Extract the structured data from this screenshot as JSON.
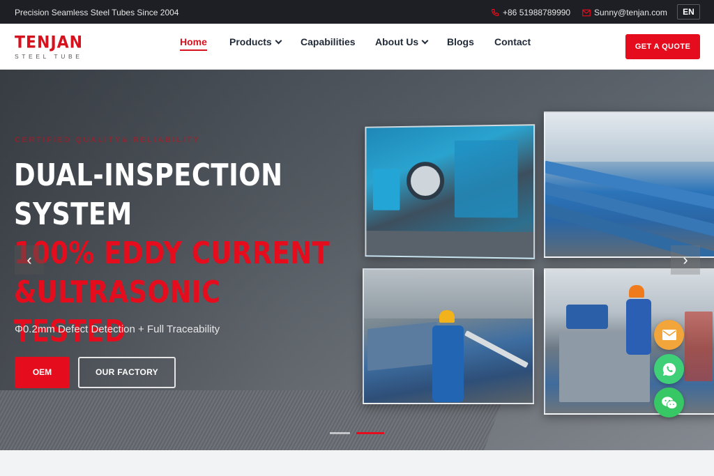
{
  "topbar": {
    "tagline": "Precision Seamless Steel Tubes Since 2004",
    "phone": "+86 51988789990",
    "email": "Sunny@tenjan.com",
    "language": "EN"
  },
  "header": {
    "logo_brand": "TENJAN",
    "logo_sub": "STEEL TUBE",
    "nav": [
      {
        "label": "Home",
        "active": true
      },
      {
        "label": "Products",
        "dropdown": true
      },
      {
        "label": "Capabilities"
      },
      {
        "label": "About Us",
        "dropdown": true
      },
      {
        "label": "Blogs"
      },
      {
        "label": "Contact"
      }
    ],
    "cta": "GET A QUOTE"
  },
  "hero": {
    "eyebrow": "CERTIFIED QUALITY& RELIABILITY",
    "title_line1": "DUAL-INSPECTION",
    "title_line2": "SYSTEM",
    "title_red_line1": "100% EDDY CURRENT",
    "title_red_line2": "&ULTRASONIC TESTED",
    "subtitle": "Φ0.2mm Defect Detection + Full Traceability",
    "btn_primary": "OEM",
    "btn_secondary": "OUR FACTORY",
    "prev_arrow": "‹",
    "next_arrow": "›",
    "slides_total": 2,
    "active_slide": 2
  },
  "colors": {
    "accent": "#e50d1d",
    "topbar_bg": "#1d1f24",
    "whatsapp": "#3fcf77",
    "mail": "#f2a53a"
  },
  "floating_contacts": [
    {
      "icon": "mail-icon"
    },
    {
      "icon": "whatsapp-icon"
    },
    {
      "icon": "wechat-icon"
    }
  ]
}
